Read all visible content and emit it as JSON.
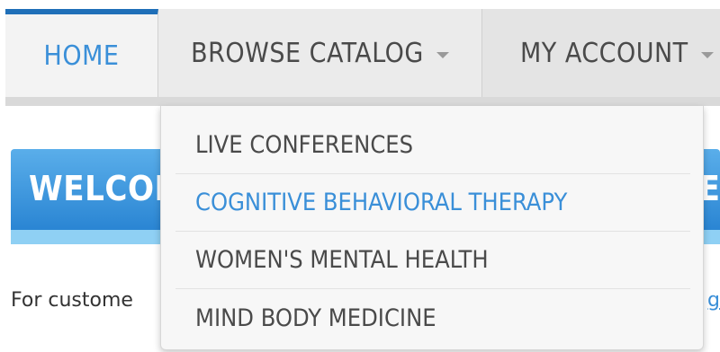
{
  "nav": {
    "items": [
      {
        "label": "HOME"
      },
      {
        "label": "BROWSE CATALOG"
      },
      {
        "label": "MY ACCOUNT"
      }
    ]
  },
  "banner": {
    "title": "WELCOM",
    "trailing": "E"
  },
  "body": {
    "text": "For custome",
    "link_fragment": "g"
  },
  "dropdown": {
    "items": [
      {
        "label": "LIVE CONFERENCES"
      },
      {
        "label": "COGNITIVE BEHAVIORAL THERAPY"
      },
      {
        "label": "WOMEN'S MENTAL HEALTH"
      },
      {
        "label": "MIND BODY MEDICINE"
      }
    ]
  },
  "colors": {
    "accent": "#3a8fd8",
    "nav_bg": "#e4e4e4",
    "banner_top": "#5aaeea",
    "banner_bottom": "#2a85d3"
  }
}
